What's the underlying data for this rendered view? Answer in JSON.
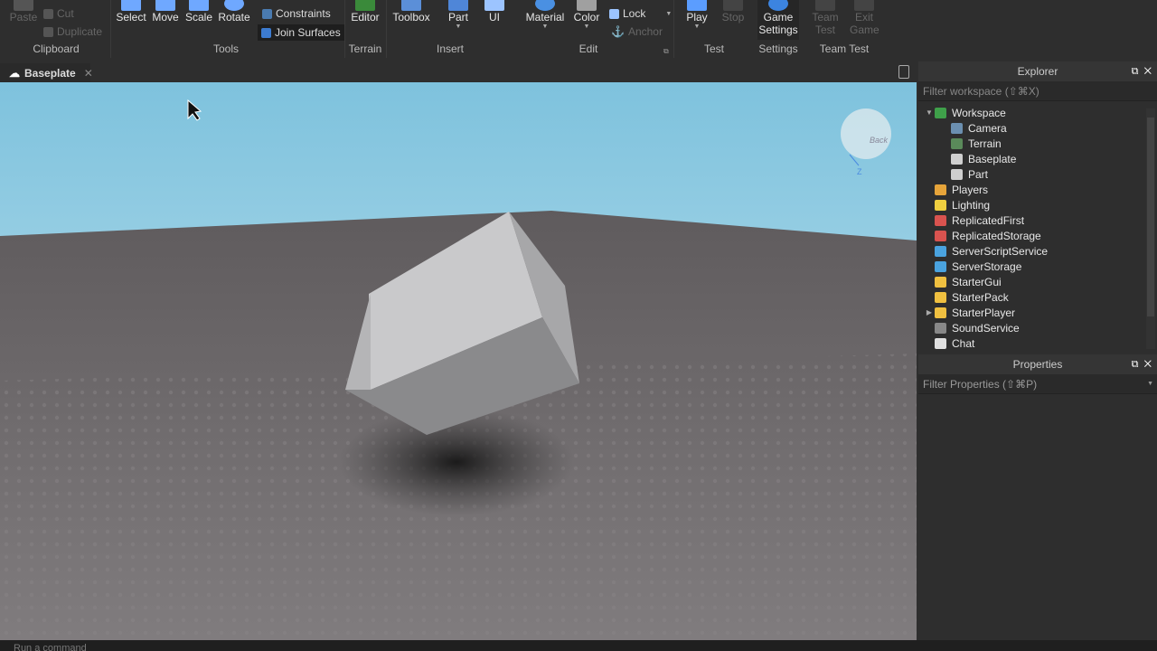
{
  "ribbon": {
    "clipboard": {
      "paste": "Paste",
      "cut": "Cut",
      "duplicate": "Duplicate",
      "group": "Clipboard"
    },
    "tools": {
      "select": "Select",
      "move": "Move",
      "scale": "Scale",
      "rotate": "Rotate",
      "constraints": "Constraints",
      "join_surfaces": "Join Surfaces",
      "group": "Tools"
    },
    "terrain": {
      "editor": "Editor",
      "group": "Terrain"
    },
    "insert": {
      "toolbox": "Toolbox",
      "part": "Part",
      "ui": "UI",
      "group": "Insert"
    },
    "edit": {
      "material": "Material",
      "color": "Color",
      "lock": "Lock",
      "anchor": "Anchor",
      "group": "Edit"
    },
    "test": {
      "play": "Play",
      "stop": "Stop",
      "group": "Test"
    },
    "settings": {
      "game_settings_1": "Game",
      "game_settings_2": "Settings",
      "group": "Settings"
    },
    "team_test": {
      "team_test_1": "Team",
      "team_test_2": "Test",
      "exit_game_1": "Exit",
      "exit_game_2": "Game",
      "group": "Team Test"
    }
  },
  "tab": {
    "label": "Baseplate"
  },
  "viewport": {
    "view_cube_label": "Back",
    "axis_label": "Z",
    "colors": {
      "sky": "#a9d8ea",
      "floor": "#6a6668"
    }
  },
  "explorer": {
    "title": "Explorer",
    "filter_placeholder": "Filter workspace (⇧⌘X)",
    "items": [
      {
        "label": "Workspace",
        "indent": 0,
        "expanded": true,
        "color": "#3fa04a"
      },
      {
        "label": "Camera",
        "indent": 1,
        "color": "#6b8fb0"
      },
      {
        "label": "Terrain",
        "indent": 1,
        "color": "#5a8a5a"
      },
      {
        "label": "Baseplate",
        "indent": 1,
        "color": "#cfcfcf"
      },
      {
        "label": "Part",
        "indent": 1,
        "color": "#cfcfcf"
      },
      {
        "label": "Players",
        "indent": 0,
        "color": "#e6a43a"
      },
      {
        "label": "Lighting",
        "indent": 0,
        "color": "#f0d040"
      },
      {
        "label": "ReplicatedFirst",
        "indent": 0,
        "color": "#d9534f"
      },
      {
        "label": "ReplicatedStorage",
        "indent": 0,
        "color": "#d9534f"
      },
      {
        "label": "ServerScriptService",
        "indent": 0,
        "color": "#4aa3df"
      },
      {
        "label": "ServerStorage",
        "indent": 0,
        "color": "#4aa3df"
      },
      {
        "label": "StarterGui",
        "indent": 0,
        "color": "#f0c040"
      },
      {
        "label": "StarterPack",
        "indent": 0,
        "color": "#f0c040"
      },
      {
        "label": "StarterPlayer",
        "indent": 0,
        "collapsed": true,
        "color": "#f0c040"
      },
      {
        "label": "SoundService",
        "indent": 0,
        "color": "#888888"
      },
      {
        "label": "Chat",
        "indent": 0,
        "color": "#e0e0e0"
      }
    ]
  },
  "properties": {
    "title": "Properties",
    "filter_placeholder": "Filter Properties (⇧⌘P)"
  },
  "command_bar": {
    "placeholder": "Run a command"
  }
}
